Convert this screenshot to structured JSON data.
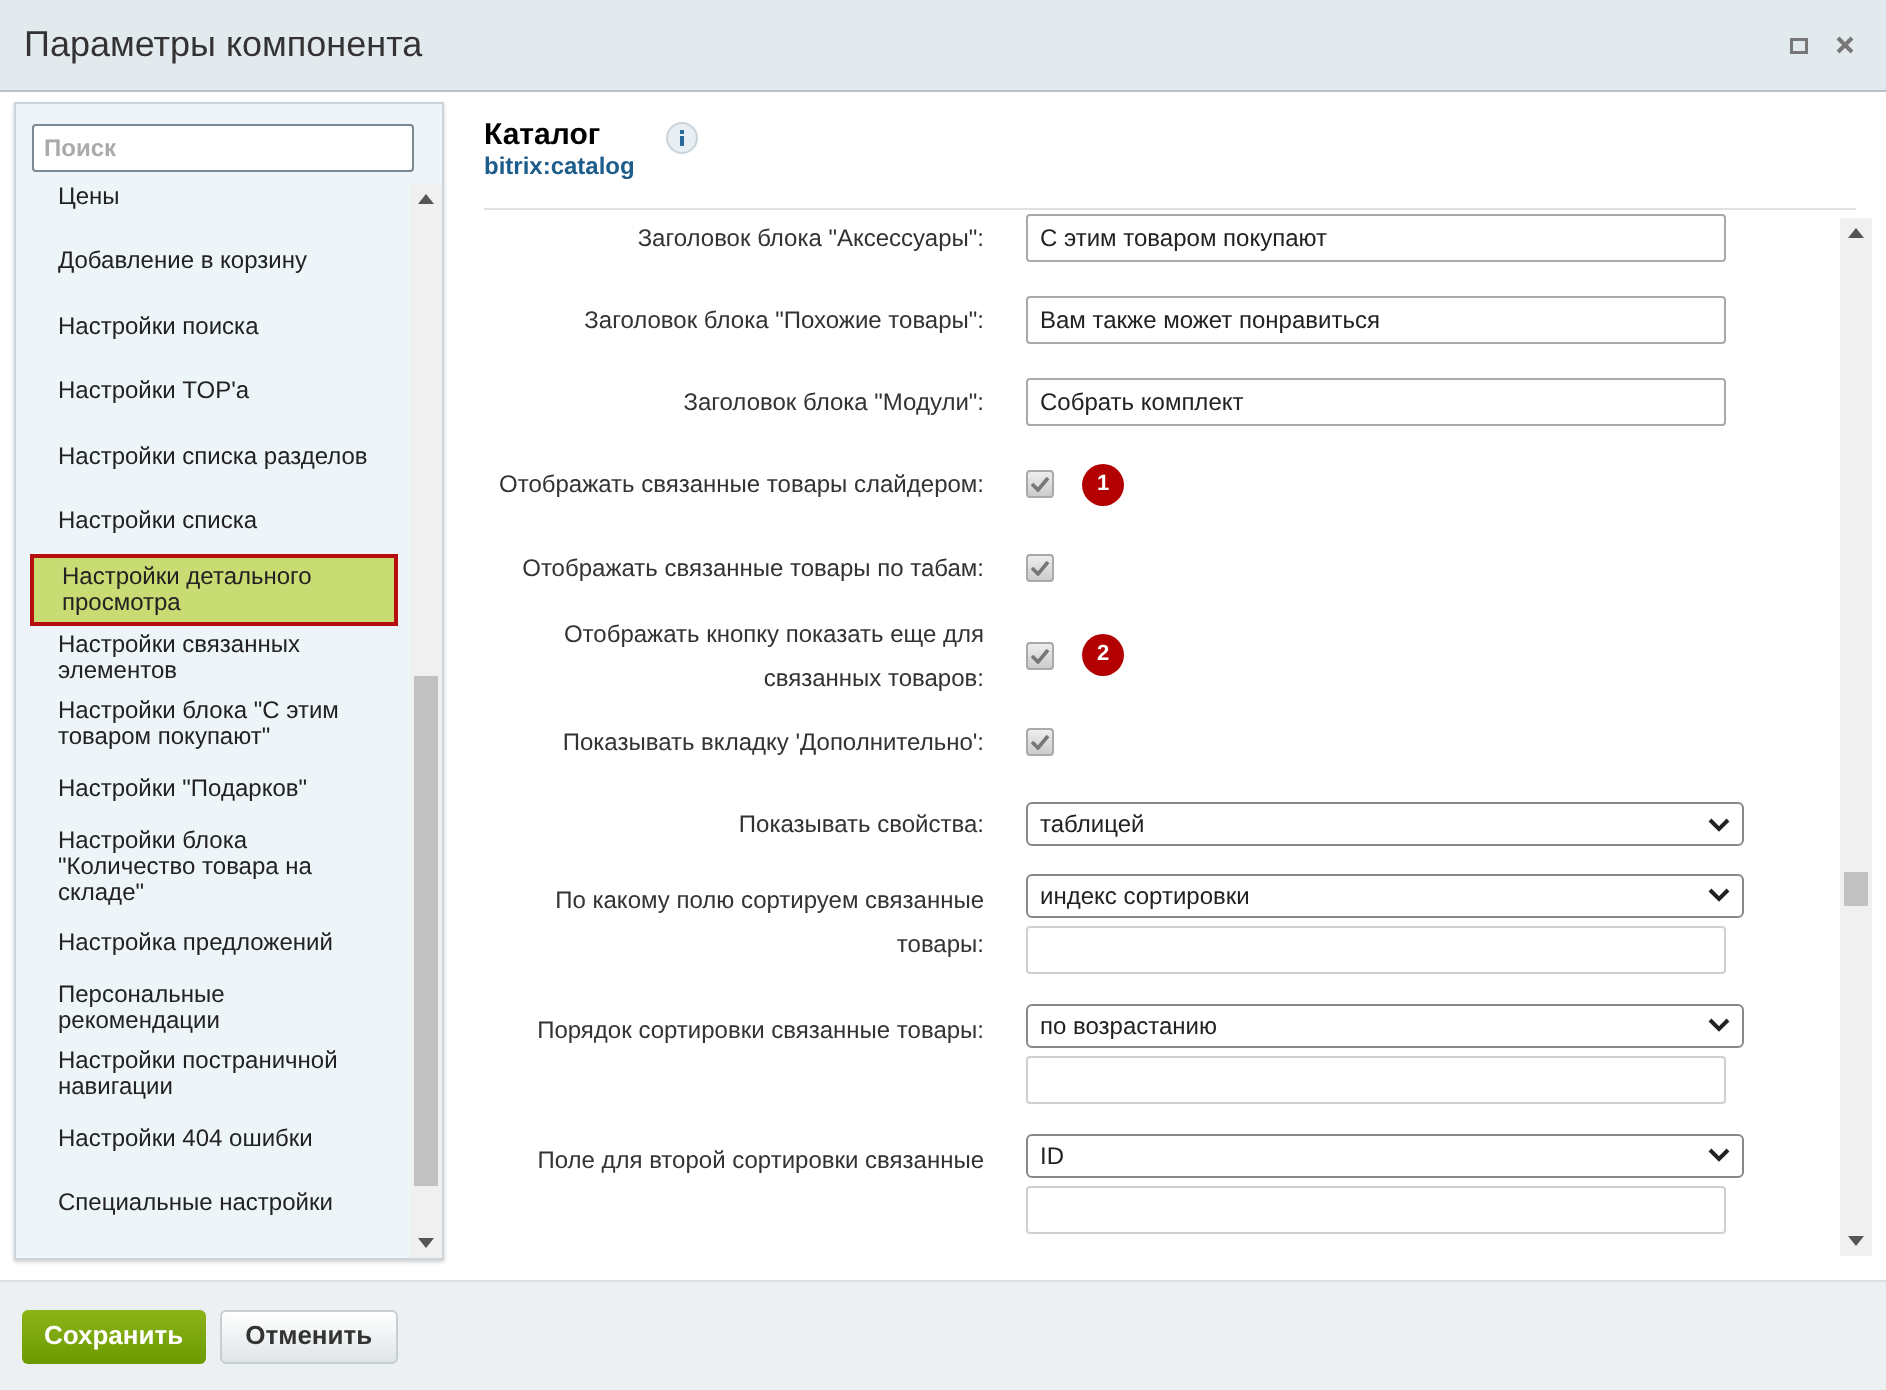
{
  "window": {
    "title": "Параметры компонента"
  },
  "search": {
    "placeholder": "Поиск"
  },
  "sidebar": {
    "items": [
      {
        "label": "Цены",
        "selected": false
      },
      {
        "label": "Добавление в корзину",
        "selected": false
      },
      {
        "label": "Настройки поиска",
        "selected": false
      },
      {
        "label": "Настройки TOP'а",
        "selected": false
      },
      {
        "label": "Настройки списка разделов",
        "selected": false
      },
      {
        "label": "Настройки списка",
        "selected": false
      },
      {
        "label": "Настройки детального просмотра",
        "selected": true
      },
      {
        "label": "Настройки связанных элементов",
        "selected": false
      },
      {
        "label": "Настройки блока \"С этим товаром покупают\"",
        "selected": false
      },
      {
        "label": "Настройки \"Подарков\"",
        "selected": false
      },
      {
        "label": "Настройки блока \"Количество товара на складе\"",
        "selected": false
      },
      {
        "label": "Настройка предложений",
        "selected": false
      },
      {
        "label": "Персональные рекомендации",
        "selected": false
      },
      {
        "label": "Настройки постраничной навигации",
        "selected": false
      },
      {
        "label": "Настройки 404 ошибки",
        "selected": false
      },
      {
        "label": "Специальные настройки",
        "selected": false
      }
    ]
  },
  "component": {
    "title": "Каталог",
    "code": "bitrix:catalog"
  },
  "fields": [
    {
      "kind": "text",
      "label": "Заголовок блока \"Аксессуары\":",
      "value": "С этим товаром покупают"
    },
    {
      "kind": "text",
      "label": "Заголовок блока \"Похожие товары\":",
      "value": "Вам также может понравиться"
    },
    {
      "kind": "text",
      "label": "Заголовок блока \"Модули\":",
      "value": "Собрать комплект"
    },
    {
      "kind": "checkbox",
      "label": "Отображать связанные товары слайдером:",
      "checked": true,
      "marker": "1"
    },
    {
      "kind": "checkbox",
      "label": "Отображать связанные товары по табам:",
      "checked": true
    },
    {
      "kind": "checkbox",
      "label": "Отображать кнопку показать еще для связанных товаров:",
      "checked": true,
      "marker": "2"
    },
    {
      "kind": "checkbox",
      "label": "Показывать вкладку 'Дополнительно':",
      "checked": true
    },
    {
      "kind": "select",
      "label": "Показывать свойства:",
      "value": "таблицей"
    },
    {
      "kind": "select",
      "label": "По какому полю сортируем связанные товары:",
      "value": "индекс сортировки",
      "extra_input": true
    },
    {
      "kind": "select",
      "label": "Порядок сортировки связанные товары:",
      "value": "по возрастанию",
      "extra_input": true
    },
    {
      "kind": "select",
      "label": "Поле для второй сортировки связанные",
      "value": "ID",
      "extra_input": true
    }
  ],
  "buttons": [
    {
      "label": "Сохранить",
      "kind": "primary"
    },
    {
      "label": "Отменить",
      "kind": "secondary"
    }
  ]
}
